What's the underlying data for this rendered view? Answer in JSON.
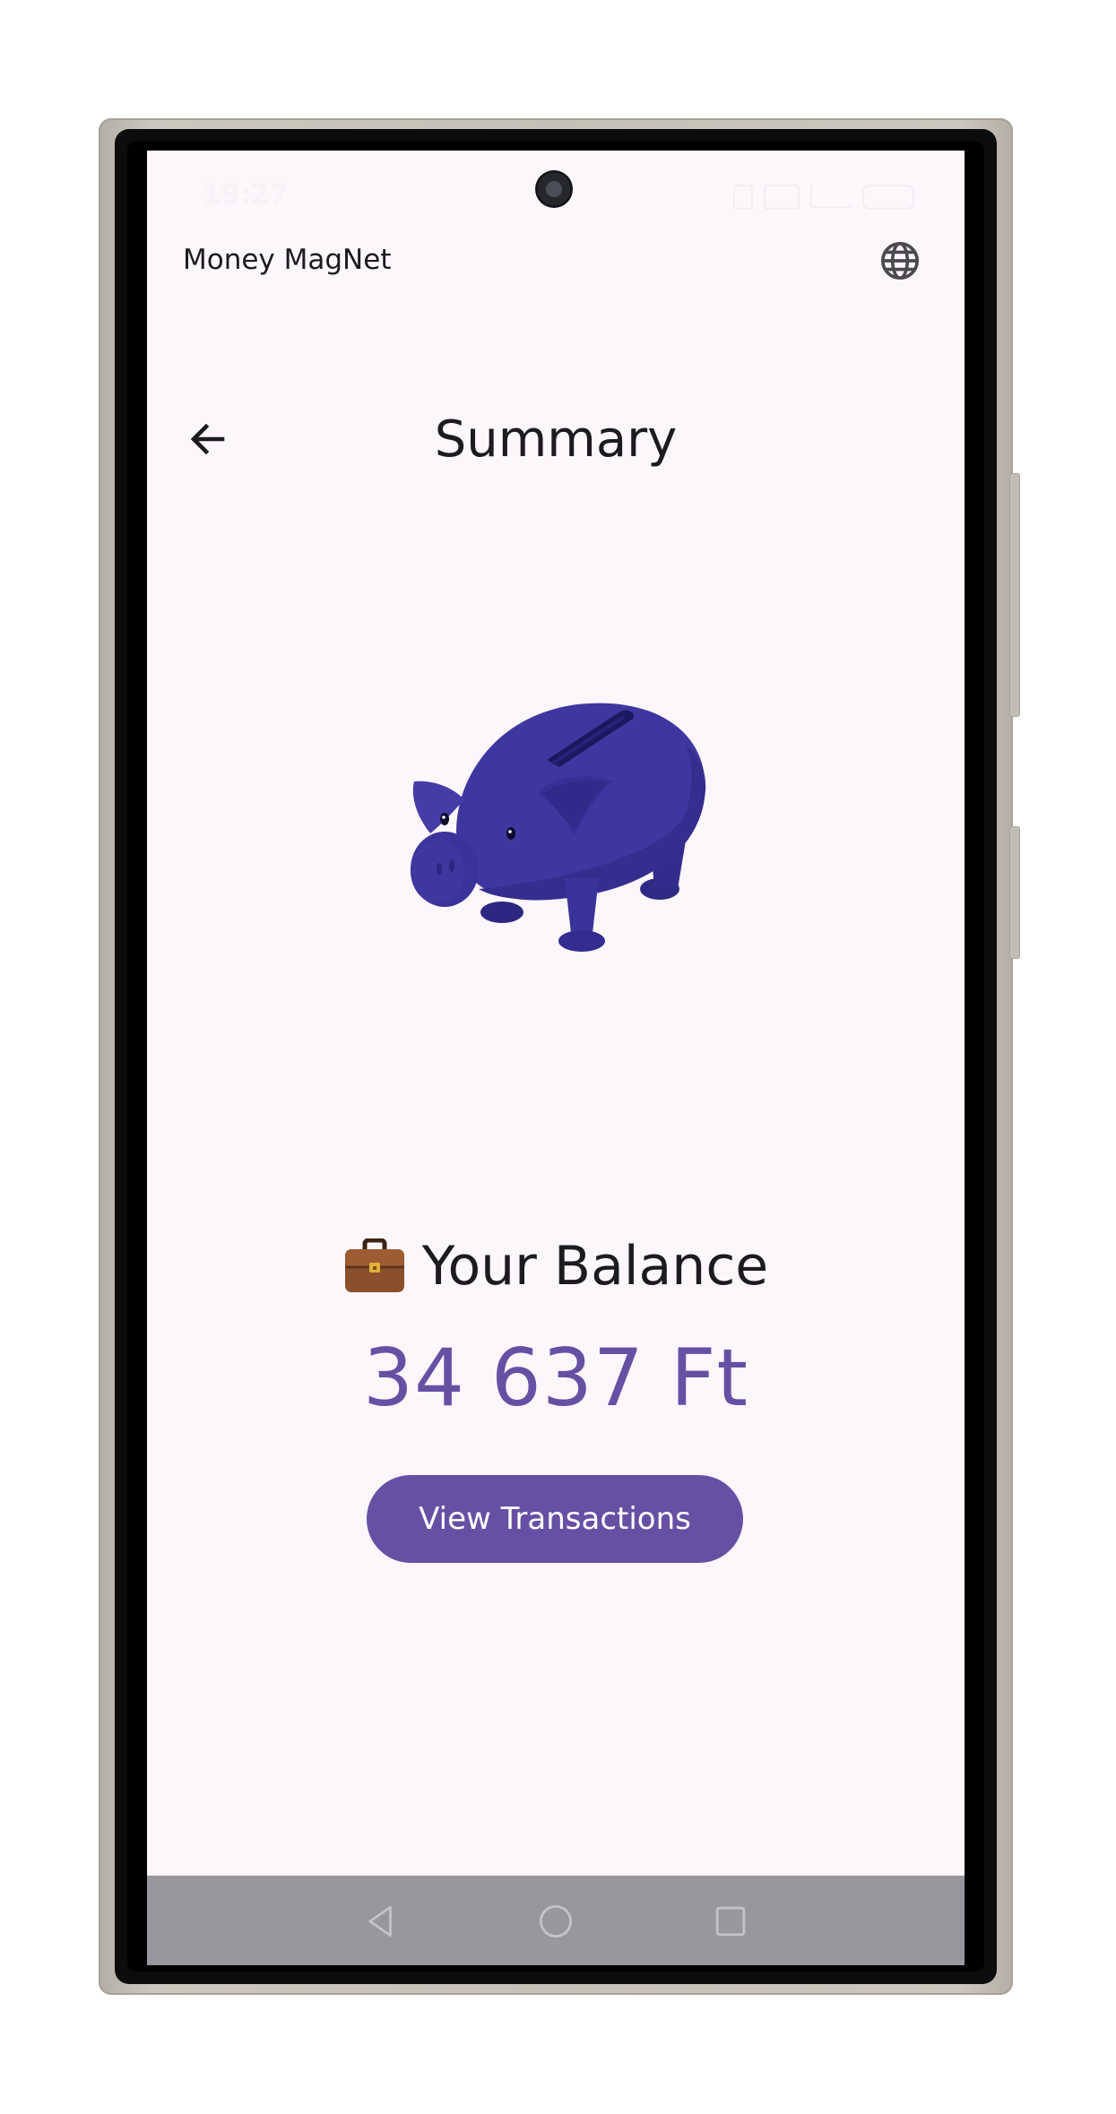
{
  "status_bar": {
    "time": "19:27"
  },
  "app_bar": {
    "app_name": "Money MagNet",
    "language_icon": "globe-icon"
  },
  "header": {
    "back_icon": "arrow-back-icon",
    "title": "Summary"
  },
  "illustration": {
    "icon": "piggy-bank-icon",
    "color": "#3f37a0"
  },
  "balance": {
    "label_icon": "briefcase-icon",
    "label": "Your Balance",
    "amount": "34 637 Ft"
  },
  "actions": {
    "view_transactions_label": "View Transactions"
  },
  "navigation_bar": {
    "back": "triangle-back-icon",
    "home": "circle-home-icon",
    "recents": "square-recents-icon"
  },
  "colors": {
    "primary": "#6750a4",
    "background": "#fdf7fc",
    "on_surface": "#1c1b1f",
    "nav_bar": "#99979d"
  }
}
